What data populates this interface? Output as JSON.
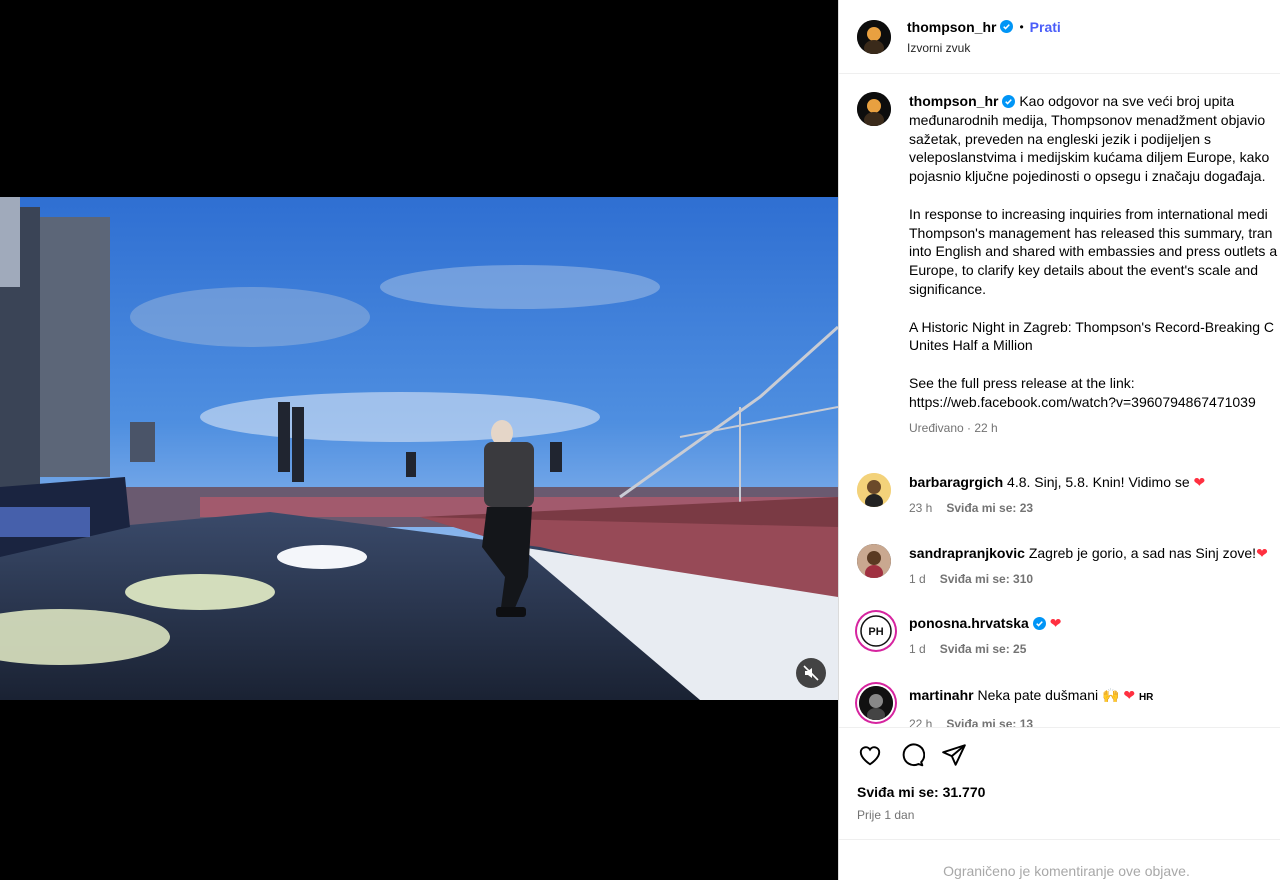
{
  "post": {
    "author": "thompson_hr",
    "follow_label": "Prati",
    "audio_label": "Izvorni zvuk",
    "caption": {
      "lines": [
        "Kao odgovor na sve veći broj upita",
        "međunarodnih medija, Thompsonov menadžment objavio",
        "sažetak, preveden na engleski jezik i podijeljen s",
        "veleposlanstvima i medijskim kućama diljem Europe, kako",
        "pojasnio ključne pojedinosti o opsegu i značaju događaja.",
        "",
        "In response to increasing inquiries from international medi",
        "Thompson's management has released this summary, tran",
        "into English and shared with embassies and press outlets a",
        "Europe, to clarify key details about the event's scale and",
        "significance.",
        "",
        "A Historic Night in Zagreb: Thompson's Record-Breaking C",
        "Unites Half a Million",
        "",
        "See the full press release at the link:",
        "https://web.facebook.com/watch?v=3960794867471039"
      ],
      "meta": "Uređivano · 22 h"
    },
    "likes_label": "Sviđa mi se: 31.770",
    "posted": "Prije 1 dan",
    "comments_restricted": "Ograničeno je komentiranje ove objave."
  },
  "comments": [
    {
      "user": "barbaragrgich",
      "text": "4.8. Sinj, 5.8. Knin! Vidimo se",
      "emoji": "❤",
      "age": "23 h",
      "likes": "Sviđa mi se: 23",
      "verified": false,
      "tag": ""
    },
    {
      "user": "sandrapranjkovic",
      "text": "Zagreb je gorio, a sad nas Sinj zove!",
      "emoji": "❤",
      "age": "1 d",
      "likes": "Sviđa mi se: 310",
      "verified": false,
      "tag": ""
    },
    {
      "user": "ponosna.hrvatska",
      "text": "",
      "emoji": "❤",
      "age": "1 d",
      "likes": "Sviđa mi se: 25",
      "verified": true,
      "tag": ""
    },
    {
      "user": "martinahr",
      "text": "Neka pate dušmani",
      "emoji": "🙌 ❤",
      "age": "22 h",
      "likes": "Sviđa mi se: 13",
      "verified": false,
      "tag": "HR"
    }
  ],
  "avatars": {
    "ph_text": "PH"
  },
  "colors": {
    "follow": "#4a5df9",
    "verified": "#0095f6",
    "heart": "#ff3040"
  },
  "icons": [
    "verified-icon",
    "heart-icon",
    "comment-icon",
    "share-icon",
    "mute-icon"
  ]
}
